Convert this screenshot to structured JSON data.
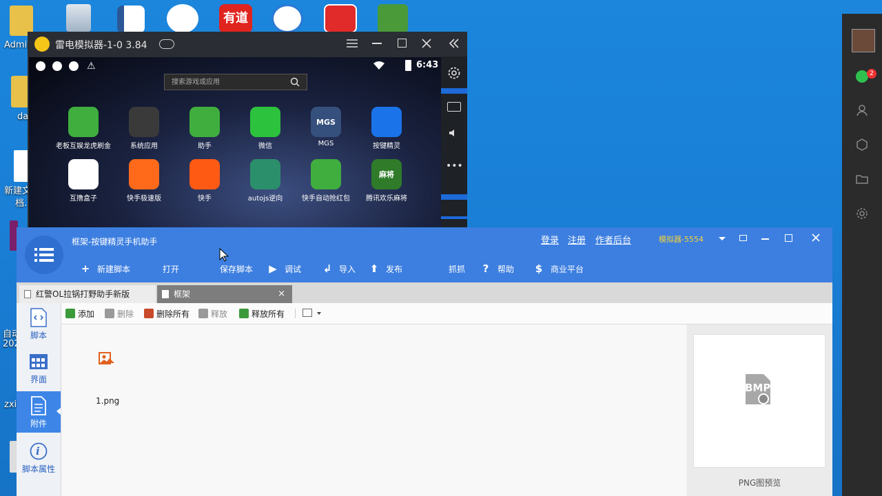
{
  "desktop": {
    "labels": [
      "Admin",
      "da",
      "新建文",
      "档.",
      "自动",
      "202",
      "zxi"
    ],
    "rightbar_badge": "2"
  },
  "emulator": {
    "title": "雷电模拟器-1-0 3.84",
    "time": "6:43",
    "search_placeholder": "搜索游戏或应用",
    "apps": [
      {
        "label": "老板互娱龙虎刷金",
        "color": "#3fae3f",
        "glyph": ""
      },
      {
        "label": "系统应用",
        "color": "#3a3a3a",
        "glyph": ""
      },
      {
        "label": "助手",
        "color": "#3fae3f",
        "glyph": ""
      },
      {
        "label": "微信",
        "color": "#2dc23e",
        "glyph": ""
      },
      {
        "label": "MGS",
        "color": "#35507c",
        "glyph": "MGS"
      },
      {
        "label": "按键精灵",
        "color": "#1a73e8",
        "glyph": ""
      },
      {
        "label": "互撸盒子",
        "color": "#ffffff",
        "glyph": ""
      },
      {
        "label": "快手极速版",
        "color": "#ff6a1a",
        "glyph": ""
      },
      {
        "label": "快手",
        "color": "#ff5a14",
        "glyph": ""
      },
      {
        "label": "autojs逆向",
        "color": "#2a8f6a",
        "glyph": ""
      },
      {
        "label": "快手自动抢红包",
        "color": "#3fae3f",
        "glyph": ""
      },
      {
        "label": "腾讯欢乐麻将",
        "color": "#2f7b2a",
        "glyph": "麻将"
      }
    ]
  },
  "app": {
    "title": "框架-按键精灵手机助手",
    "links": {
      "login": "登录",
      "register": "注册",
      "author": "作者后台"
    },
    "device": "模拟器-5554",
    "toolbar": [
      {
        "label": "新建脚本",
        "icon": "plus-icon",
        "glyph": "+"
      },
      {
        "label": "打开",
        "icon": "folder-icon",
        "glyph": ""
      },
      {
        "label": "保存脚本",
        "icon": "save-icon",
        "glyph": ""
      },
      {
        "label": "调试",
        "icon": "play-icon",
        "glyph": "▶"
      },
      {
        "label": "导入",
        "icon": "import-icon",
        "glyph": "↲"
      },
      {
        "label": "发布",
        "icon": "publish-icon",
        "glyph": "⬆"
      },
      {
        "label": "抓抓",
        "icon": "camera-icon",
        "glyph": ""
      },
      {
        "label": "帮助",
        "icon": "help-icon",
        "glyph": "?"
      },
      {
        "label": "商业平台",
        "icon": "business-icon",
        "glyph": "$"
      }
    ],
    "tabs": [
      {
        "label": "红警OL拉锅打野助手新版"
      },
      {
        "label": "框架",
        "close": "×"
      }
    ],
    "sidebar": [
      {
        "label": "脚本"
      },
      {
        "label": "界面"
      },
      {
        "label": "附件"
      },
      {
        "label": "脚本属性",
        "glyph": "i"
      }
    ],
    "content_toolbar": [
      {
        "label": "添加",
        "color": "#3b9b3b"
      },
      {
        "label": "删除",
        "color": "#9a9a9a"
      },
      {
        "label": "删除所有",
        "color": "#c94a2a"
      },
      {
        "label": "释放",
        "color": "#9a9a9a"
      },
      {
        "label": "释放所有",
        "color": "#3b9b3b"
      }
    ],
    "file": {
      "name": "1.png"
    },
    "preview": {
      "badge": "BMP",
      "label": "PNG图预览"
    }
  }
}
